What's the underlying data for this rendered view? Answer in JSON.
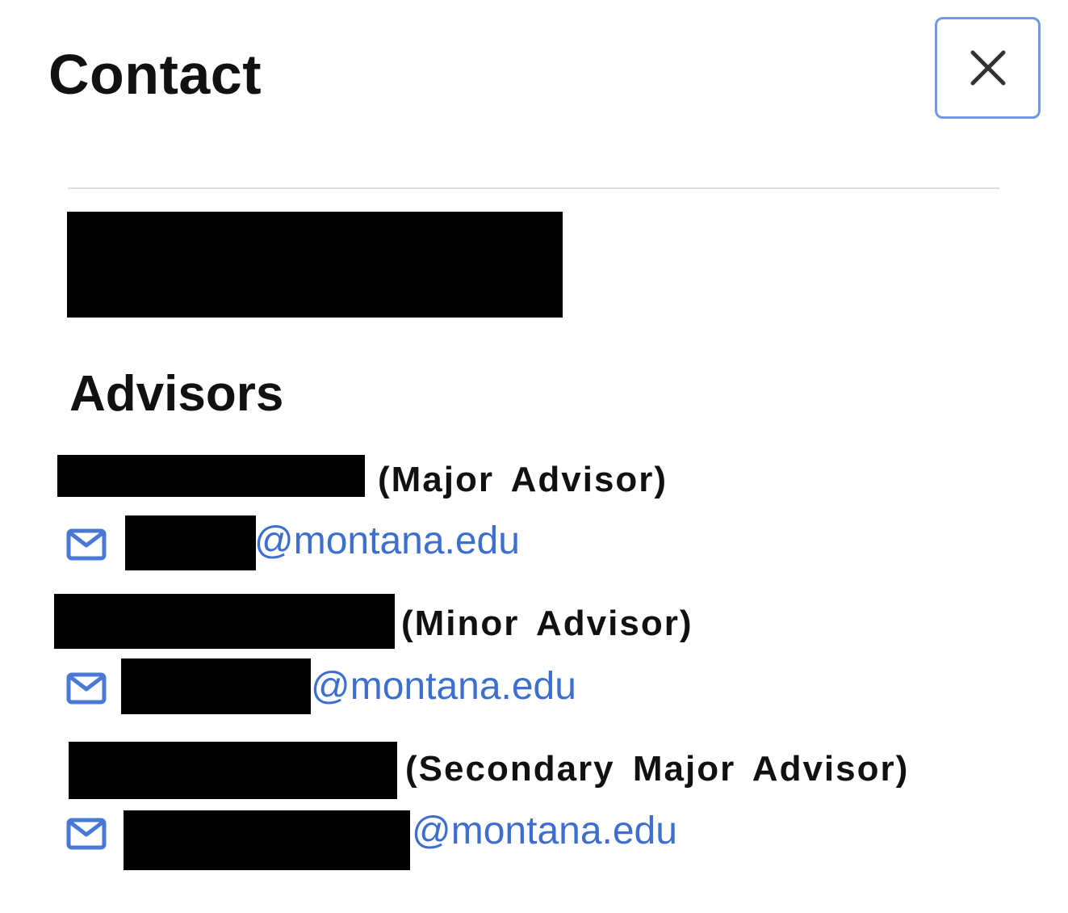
{
  "dialog": {
    "title": "Contact",
    "close_icon": "close-icon"
  },
  "advisors": {
    "heading": "Advisors",
    "items": [
      {
        "role": "(Major Advisor)",
        "email_domain": "@montana.edu",
        "icon": "mail-icon"
      },
      {
        "role": "(Minor Advisor)",
        "email_domain": "@montana.edu",
        "icon": "mail-icon"
      },
      {
        "role": "(Secondary Major Advisor)",
        "email_domain": "@montana.edu",
        "icon": "mail-icon"
      }
    ]
  },
  "colors": {
    "link": "#3e6fcf",
    "close_border": "#6f9ae3",
    "icon": "#4a78d6"
  }
}
